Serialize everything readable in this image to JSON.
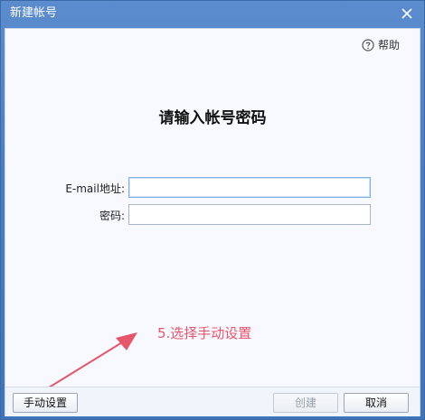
{
  "window": {
    "title": "新建帐号",
    "close_icon": "close-icon"
  },
  "help": {
    "label": "帮助",
    "icon": "question-circle-icon"
  },
  "heading": "请输入帐号密码",
  "form": {
    "email_label": "E-mail地址:",
    "email_value": "",
    "password_label": "密码:",
    "password_value": ""
  },
  "annotation": {
    "text": "5.选择手动设置",
    "color": "#e8546a"
  },
  "buttons": {
    "manual_setup": "手动设置",
    "create": "创建",
    "cancel": "取消"
  },
  "colors": {
    "titlebar": "#4a7ec4",
    "client_bg": "#f7f9fe"
  }
}
